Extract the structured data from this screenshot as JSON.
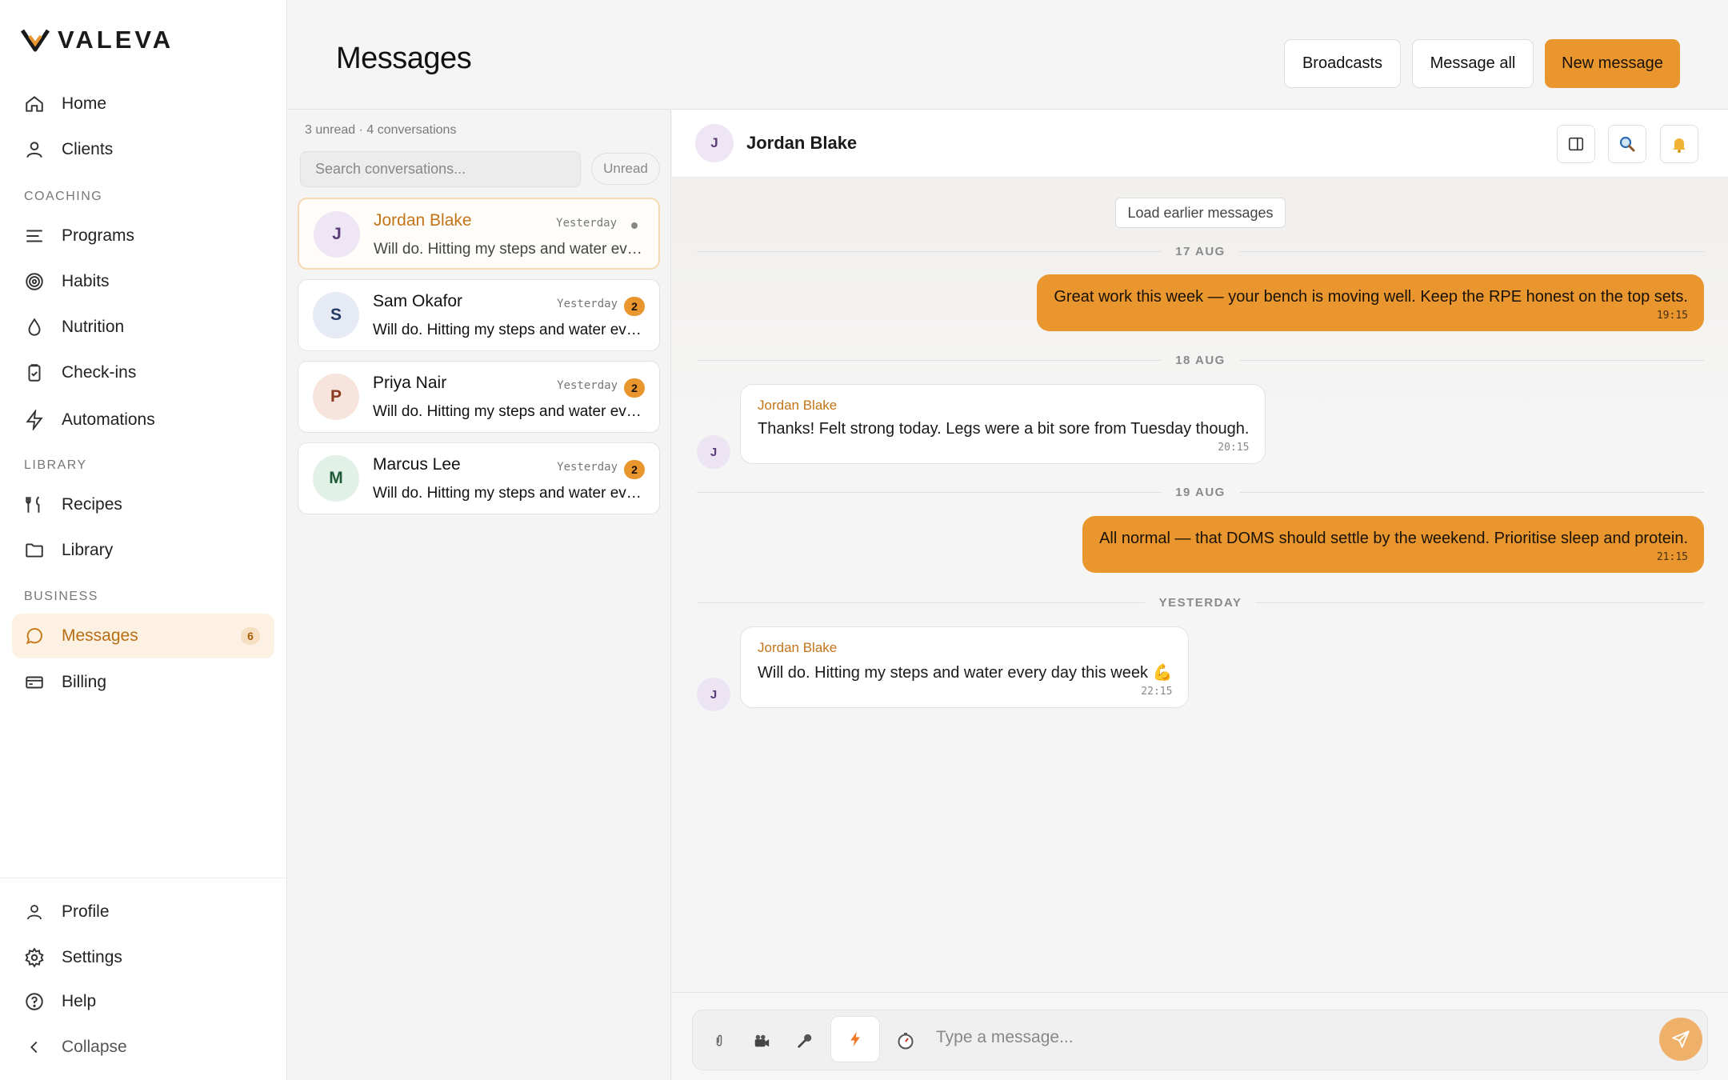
{
  "brand": {
    "name": "VALEVA",
    "accent": "#e8962d"
  },
  "sidebar": {
    "items": [
      {
        "label": "Home",
        "icon": "home-icon"
      },
      {
        "label": "Clients",
        "icon": "user-icon"
      },
      {
        "label": "Programs",
        "icon": "list-icon"
      },
      {
        "label": "Habits",
        "icon": "target-icon"
      },
      {
        "label": "Nutrition",
        "icon": "drop-icon"
      },
      {
        "label": "Check-ins",
        "icon": "clipboard-icon"
      },
      {
        "label": "Automations",
        "icon": "bolt-icon"
      },
      {
        "label": "Recipes",
        "icon": "utensils-icon"
      },
      {
        "label": "Library",
        "icon": "folder-icon"
      },
      {
        "label": "Messages",
        "icon": "message-icon",
        "count": "6",
        "active": true
      },
      {
        "label": "Billing",
        "icon": "card-icon"
      }
    ],
    "sections": {
      "coaching": "COACHING",
      "library": "LIBRARY",
      "business": "BUSINESS"
    },
    "bottom": [
      {
        "label": "Profile",
        "icon": "user-icon"
      },
      {
        "label": "Settings",
        "icon": "gear-icon"
      },
      {
        "label": "Help",
        "icon": "help-icon"
      },
      {
        "label": "Collapse",
        "icon": "chevron-left-icon"
      }
    ]
  },
  "header": {
    "title": "Messages",
    "buttons": {
      "broadcasts": "Broadcasts",
      "message_all": "Message all",
      "new_message": "New message"
    }
  },
  "conversations": {
    "summary": "3 unread · 4 conversations",
    "search_placeholder": "Search conversations...",
    "filter": "Unread",
    "items": [
      {
        "initial": "J",
        "name": "Jordan Blake",
        "time": "Yesterday",
        "preview": "Will do. Hitting my steps and water every day this week 💪",
        "selected": true
      },
      {
        "initial": "S",
        "name": "Sam Okafor",
        "time": "Yesterday",
        "unread": "2",
        "preview": "Will do. Hitting my steps and water every day this week 💪"
      },
      {
        "initial": "P",
        "name": "Priya Nair",
        "time": "Yesterday",
        "unread": "2",
        "preview": "Will do. Hitting my steps and water every day this week 💪"
      },
      {
        "initial": "M",
        "name": "Marcus Lee",
        "time": "Yesterday",
        "unread": "2",
        "preview": "Will do. Hitting my steps and water every day this week 💪"
      }
    ]
  },
  "chat": {
    "contact": {
      "initial": "J",
      "name": "Jordan Blake"
    },
    "load_earlier": "Load earlier messages",
    "dates": [
      "17 AUG",
      "18 AUG",
      "19 AUG",
      "YESTERDAY"
    ],
    "messages": [
      {
        "direction": "out",
        "text": "Great work this week — your bench is moving well. Keep the RPE honest on the top sets.",
        "time": "19:15"
      },
      {
        "direction": "in",
        "sender": "Jordan Blake",
        "text": "Thanks! Felt strong today. Legs were a bit sore from Tuesday though.",
        "time": "20:15"
      },
      {
        "direction": "out",
        "text": "All normal — that DOMS should settle by the weekend. Prioritise sleep and protein.",
        "time": "21:15"
      },
      {
        "direction": "in",
        "sender": "Jordan Blake",
        "text": "Will do. Hitting my steps and water every day this week 💪",
        "time": "22:15"
      }
    ],
    "composer_placeholder": "Type a message..."
  }
}
